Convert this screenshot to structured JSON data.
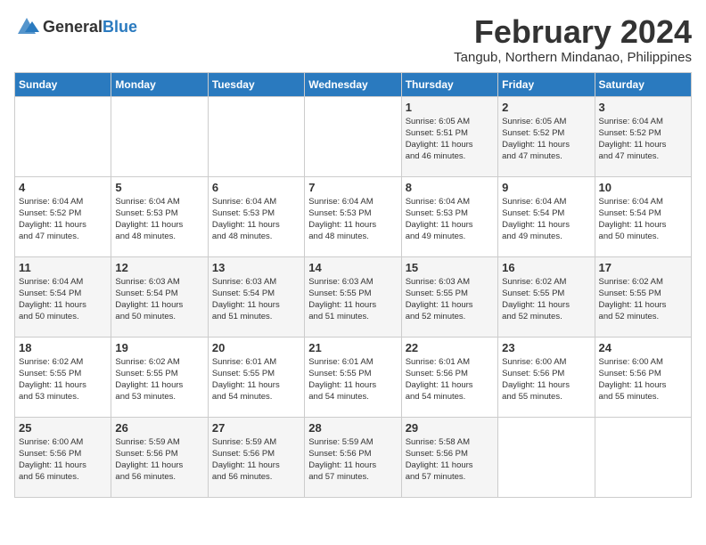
{
  "logo": {
    "general": "General",
    "blue": "Blue"
  },
  "title": "February 2024",
  "subtitle": "Tangub, Northern Mindanao, Philippines",
  "headers": [
    "Sunday",
    "Monday",
    "Tuesday",
    "Wednesday",
    "Thursday",
    "Friday",
    "Saturday"
  ],
  "weeks": [
    [
      {
        "day": "",
        "info": ""
      },
      {
        "day": "",
        "info": ""
      },
      {
        "day": "",
        "info": ""
      },
      {
        "day": "",
        "info": ""
      },
      {
        "day": "1",
        "info": "Sunrise: 6:05 AM\nSunset: 5:51 PM\nDaylight: 11 hours\nand 46 minutes."
      },
      {
        "day": "2",
        "info": "Sunrise: 6:05 AM\nSunset: 5:52 PM\nDaylight: 11 hours\nand 47 minutes."
      },
      {
        "day": "3",
        "info": "Sunrise: 6:04 AM\nSunset: 5:52 PM\nDaylight: 11 hours\nand 47 minutes."
      }
    ],
    [
      {
        "day": "4",
        "info": "Sunrise: 6:04 AM\nSunset: 5:52 PM\nDaylight: 11 hours\nand 47 minutes."
      },
      {
        "day": "5",
        "info": "Sunrise: 6:04 AM\nSunset: 5:53 PM\nDaylight: 11 hours\nand 48 minutes."
      },
      {
        "day": "6",
        "info": "Sunrise: 6:04 AM\nSunset: 5:53 PM\nDaylight: 11 hours\nand 48 minutes."
      },
      {
        "day": "7",
        "info": "Sunrise: 6:04 AM\nSunset: 5:53 PM\nDaylight: 11 hours\nand 48 minutes."
      },
      {
        "day": "8",
        "info": "Sunrise: 6:04 AM\nSunset: 5:53 PM\nDaylight: 11 hours\nand 49 minutes."
      },
      {
        "day": "9",
        "info": "Sunrise: 6:04 AM\nSunset: 5:54 PM\nDaylight: 11 hours\nand 49 minutes."
      },
      {
        "day": "10",
        "info": "Sunrise: 6:04 AM\nSunset: 5:54 PM\nDaylight: 11 hours\nand 50 minutes."
      }
    ],
    [
      {
        "day": "11",
        "info": "Sunrise: 6:04 AM\nSunset: 5:54 PM\nDaylight: 11 hours\nand 50 minutes."
      },
      {
        "day": "12",
        "info": "Sunrise: 6:03 AM\nSunset: 5:54 PM\nDaylight: 11 hours\nand 50 minutes."
      },
      {
        "day": "13",
        "info": "Sunrise: 6:03 AM\nSunset: 5:54 PM\nDaylight: 11 hours\nand 51 minutes."
      },
      {
        "day": "14",
        "info": "Sunrise: 6:03 AM\nSunset: 5:55 PM\nDaylight: 11 hours\nand 51 minutes."
      },
      {
        "day": "15",
        "info": "Sunrise: 6:03 AM\nSunset: 5:55 PM\nDaylight: 11 hours\nand 52 minutes."
      },
      {
        "day": "16",
        "info": "Sunrise: 6:02 AM\nSunset: 5:55 PM\nDaylight: 11 hours\nand 52 minutes."
      },
      {
        "day": "17",
        "info": "Sunrise: 6:02 AM\nSunset: 5:55 PM\nDaylight: 11 hours\nand 52 minutes."
      }
    ],
    [
      {
        "day": "18",
        "info": "Sunrise: 6:02 AM\nSunset: 5:55 PM\nDaylight: 11 hours\nand 53 minutes."
      },
      {
        "day": "19",
        "info": "Sunrise: 6:02 AM\nSunset: 5:55 PM\nDaylight: 11 hours\nand 53 minutes."
      },
      {
        "day": "20",
        "info": "Sunrise: 6:01 AM\nSunset: 5:55 PM\nDaylight: 11 hours\nand 54 minutes."
      },
      {
        "day": "21",
        "info": "Sunrise: 6:01 AM\nSunset: 5:55 PM\nDaylight: 11 hours\nand 54 minutes."
      },
      {
        "day": "22",
        "info": "Sunrise: 6:01 AM\nSunset: 5:56 PM\nDaylight: 11 hours\nand 54 minutes."
      },
      {
        "day": "23",
        "info": "Sunrise: 6:00 AM\nSunset: 5:56 PM\nDaylight: 11 hours\nand 55 minutes."
      },
      {
        "day": "24",
        "info": "Sunrise: 6:00 AM\nSunset: 5:56 PM\nDaylight: 11 hours\nand 55 minutes."
      }
    ],
    [
      {
        "day": "25",
        "info": "Sunrise: 6:00 AM\nSunset: 5:56 PM\nDaylight: 11 hours\nand 56 minutes."
      },
      {
        "day": "26",
        "info": "Sunrise: 5:59 AM\nSunset: 5:56 PM\nDaylight: 11 hours\nand 56 minutes."
      },
      {
        "day": "27",
        "info": "Sunrise: 5:59 AM\nSunset: 5:56 PM\nDaylight: 11 hours\nand 56 minutes."
      },
      {
        "day": "28",
        "info": "Sunrise: 5:59 AM\nSunset: 5:56 PM\nDaylight: 11 hours\nand 57 minutes."
      },
      {
        "day": "29",
        "info": "Sunrise: 5:58 AM\nSunset: 5:56 PM\nDaylight: 11 hours\nand 57 minutes."
      },
      {
        "day": "",
        "info": ""
      },
      {
        "day": "",
        "info": ""
      }
    ]
  ]
}
